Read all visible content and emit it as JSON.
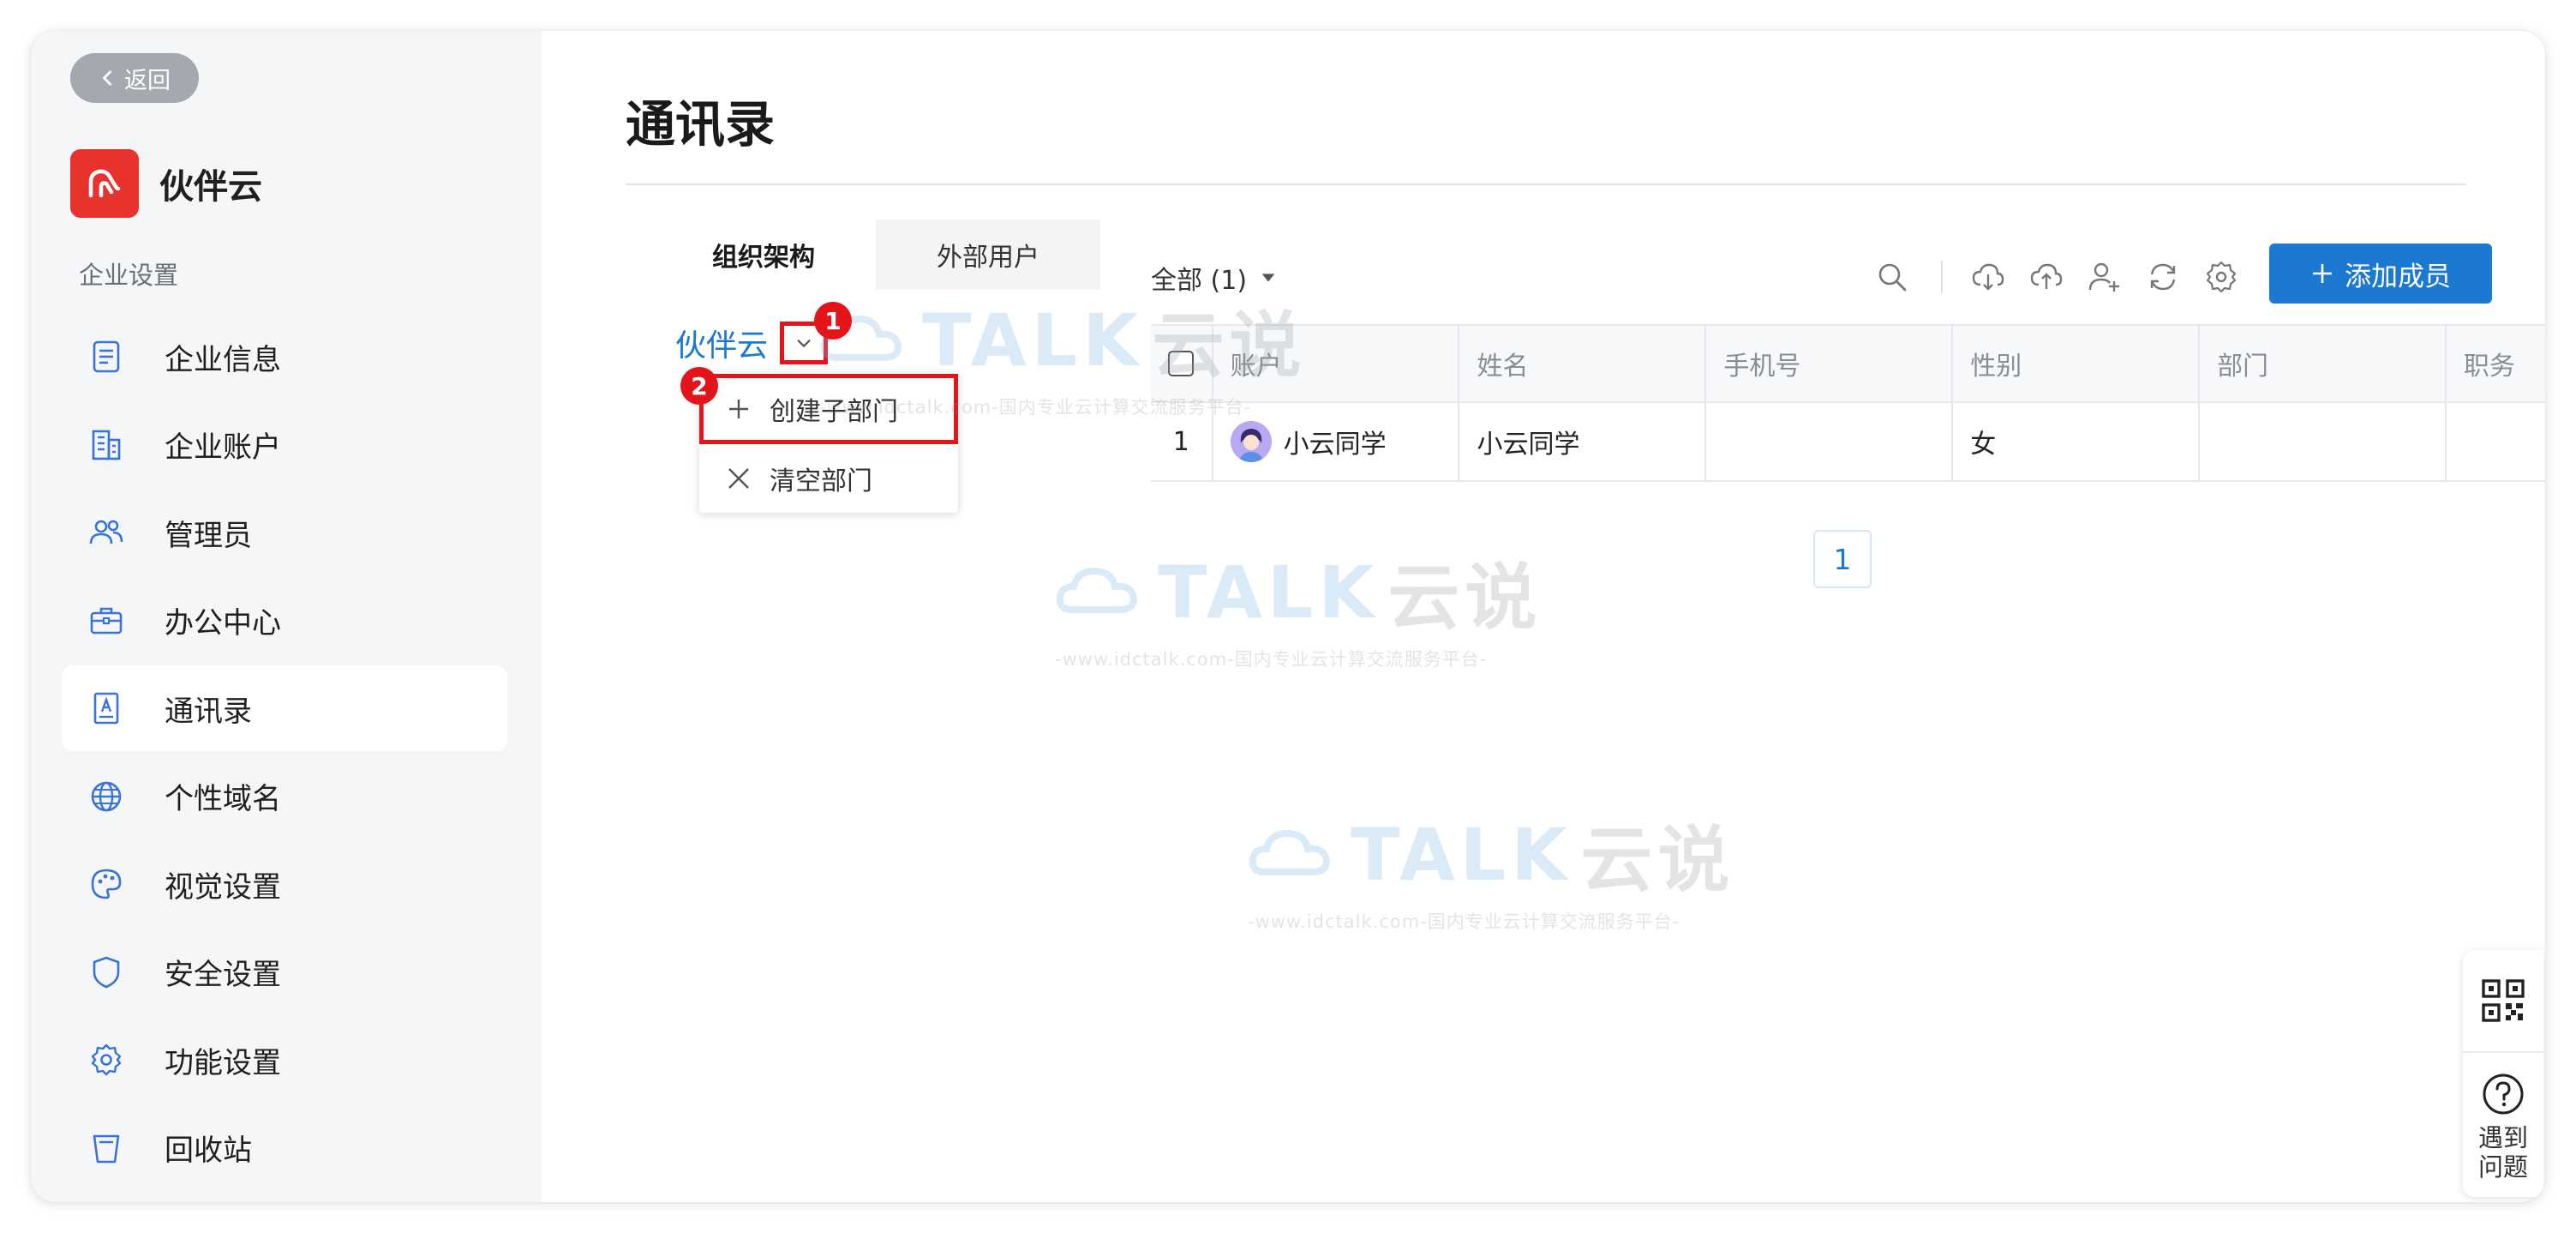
{
  "sidebar": {
    "back_label": "返回",
    "brand_name": "伙伴云",
    "section_label": "企业设置",
    "items": [
      {
        "label": "企业信息",
        "icon": "document-icon"
      },
      {
        "label": "企业账户",
        "icon": "building-icon"
      },
      {
        "label": "管理员",
        "icon": "users-icon"
      },
      {
        "label": "办公中心",
        "icon": "briefcase-icon"
      },
      {
        "label": "通讯录",
        "icon": "contacts-book-icon",
        "active": true
      },
      {
        "label": "个性域名",
        "icon": "globe-icon"
      },
      {
        "label": "视觉设置",
        "icon": "palette-icon"
      },
      {
        "label": "安全设置",
        "icon": "shield-icon"
      },
      {
        "label": "功能设置",
        "icon": "gear-icon"
      },
      {
        "label": "回收站",
        "icon": "trash-icon"
      }
    ]
  },
  "main": {
    "title": "通讯录",
    "tabs": [
      {
        "label": "组织架构",
        "active": true
      },
      {
        "label": "外部用户",
        "active": false
      }
    ],
    "tree": {
      "root_label": "伙伴云",
      "marker_1": "1",
      "marker_2": "2",
      "menu": [
        {
          "label": "创建子部门",
          "icon": "plus-icon"
        },
        {
          "label": "清空部门",
          "icon": "close-icon"
        }
      ]
    },
    "filter_label": "全部 (1)",
    "add_member_label": "添加成员",
    "table": {
      "columns": [
        "账户",
        "姓名",
        "手机号",
        "性别",
        "部门",
        "职务"
      ],
      "rows": [
        {
          "index": "1",
          "account": "小云同学",
          "name": "小云同学",
          "phone": "",
          "gender": "女",
          "department": "",
          "position": ""
        }
      ]
    },
    "pagination": {
      "current_page": "1"
    }
  },
  "float_panel": {
    "help_label": "遇到问题"
  },
  "watermark": {
    "brand": "TALK",
    "brand_cn": "云说",
    "url": "-www.idctalk.com-国内专业云计算交流服务平台-"
  },
  "colors": {
    "accent": "#1b79d1",
    "brand_red": "#e8322e",
    "annotation_red": "#e3151a"
  }
}
